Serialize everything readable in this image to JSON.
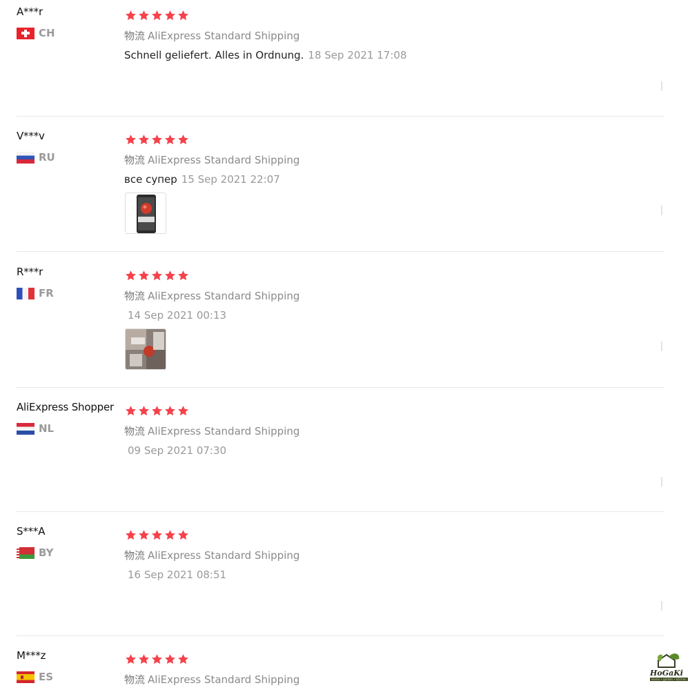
{
  "colors": {
    "star": "#f5424b",
    "muted": "#999999",
    "divider": "#e6e6e6"
  },
  "reviews": [
    {
      "user": "A***r",
      "country": "CH",
      "flag": "switzerland-flag",
      "rating": 5,
      "logistics_label": "物流",
      "logistics": "AliExpress Standard Shipping",
      "text": "Schnell geliefert. Alles in Ordnung.",
      "date": "18 Sep 2021 17:08",
      "photos": 0
    },
    {
      "user": "V***v",
      "country": "RU",
      "flag": "russia-flag",
      "rating": 5,
      "logistics_label": "物流",
      "logistics": "AliExpress Standard Shipping",
      "text": "все супер",
      "date": "15 Sep 2021 22:07",
      "photos": 1
    },
    {
      "user": "R***r",
      "country": "FR",
      "flag": "france-flag",
      "rating": 5,
      "logistics_label": "物流",
      "logistics": "AliExpress Standard Shipping",
      "text": "",
      "date": "14 Sep 2021 00:13",
      "photos": 1
    },
    {
      "user": "AliExpress Shopper",
      "country": "NL",
      "flag": "netherlands-flag",
      "rating": 5,
      "logistics_label": "物流",
      "logistics": "AliExpress Standard Shipping",
      "text": "",
      "date": "09 Sep 2021 07:30",
      "photos": 0
    },
    {
      "user": "S***A",
      "country": "BY",
      "flag": "belarus-flag",
      "rating": 5,
      "logistics_label": "物流",
      "logistics": "AliExpress Standard Shipping",
      "text": "",
      "date": "16 Sep 2021 08:51",
      "photos": 0
    },
    {
      "user": "M***z",
      "country": "ES",
      "flag": "spain-flag",
      "rating": 5,
      "logistics_label": "物流",
      "logistics": "AliExpress Standard Shipping",
      "text": "",
      "date": "",
      "photos": 0
    }
  ],
  "watermark": {
    "name": "HoGaKi",
    "tagline": "Home • garden • kitchen",
    "icon": "house-leaf-logo-icon"
  }
}
